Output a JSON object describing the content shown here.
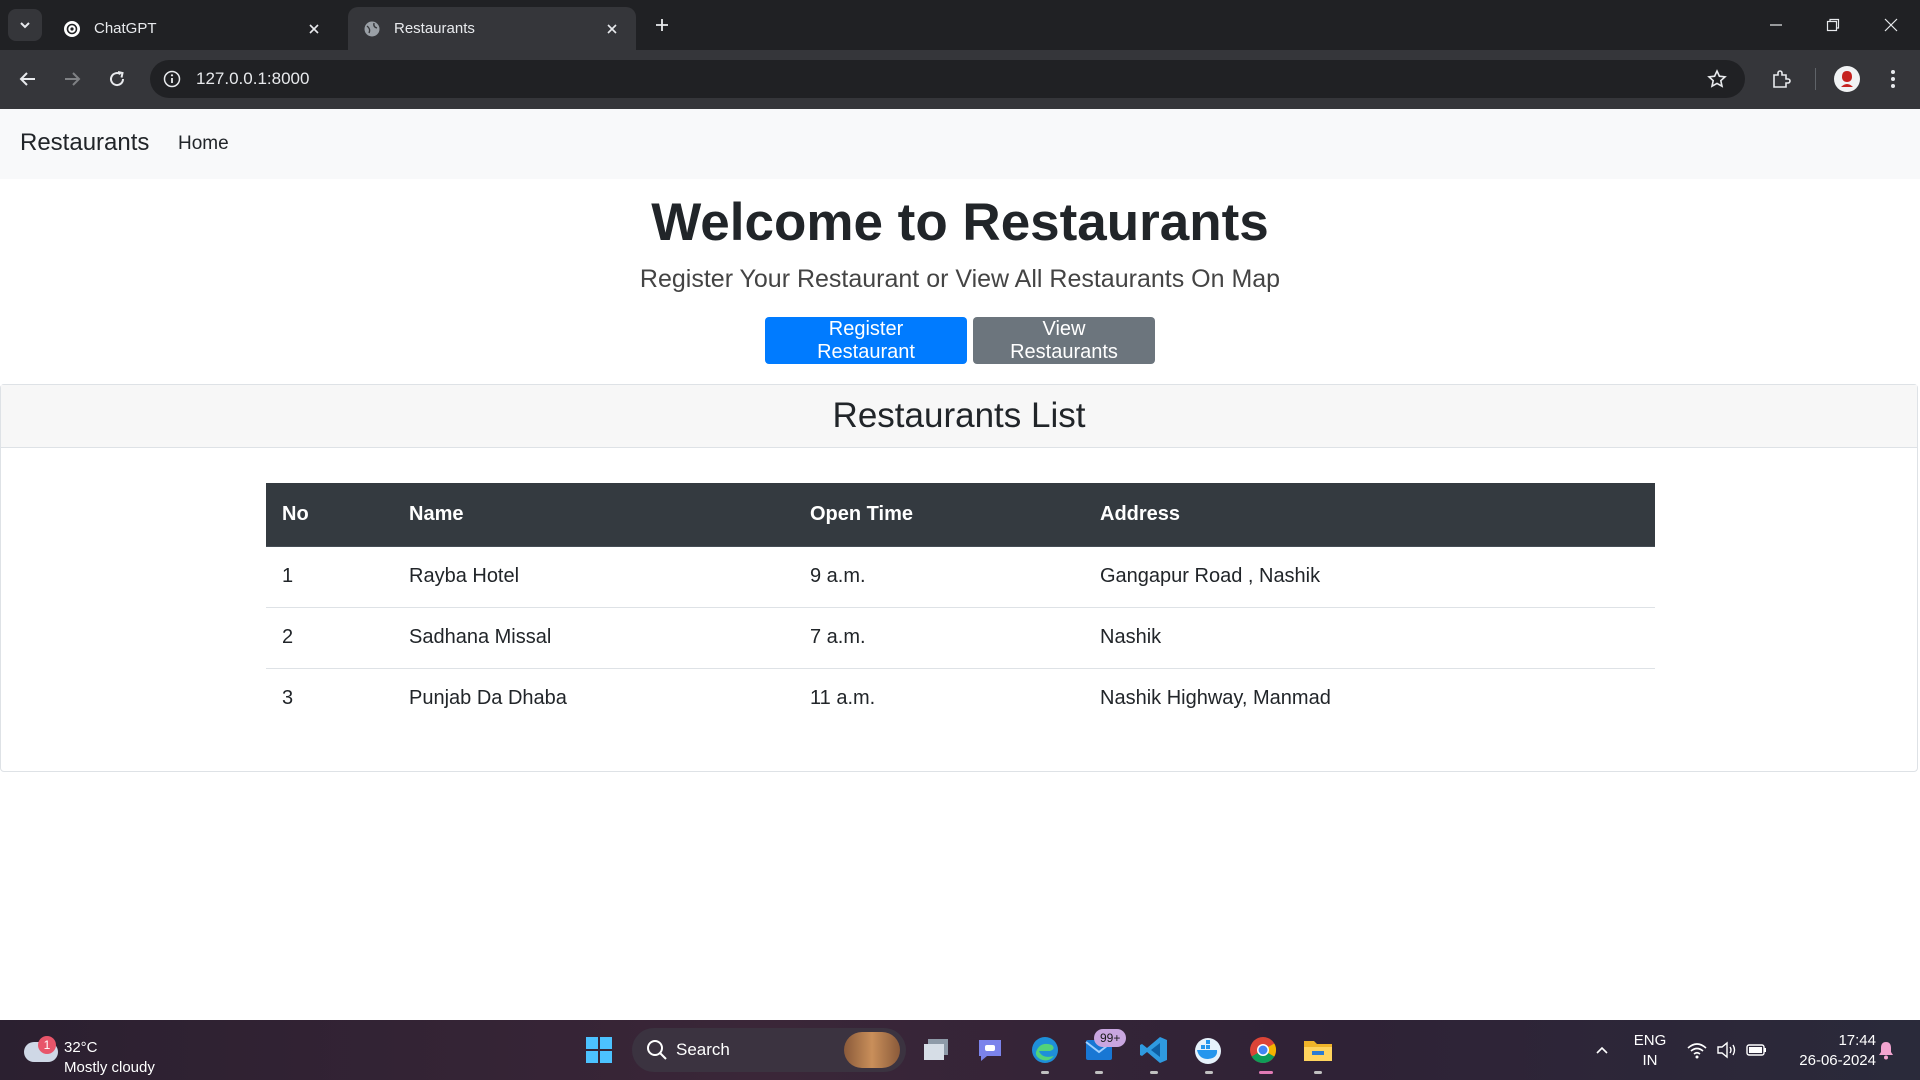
{
  "browser": {
    "tabs": [
      {
        "title": "ChatGPT",
        "icon": "chatgpt-icon",
        "active": false
      },
      {
        "title": "Restaurants",
        "icon": "globe-icon",
        "active": true
      }
    ],
    "url": "127.0.0.1:8000"
  },
  "page": {
    "navbar": {
      "brand": "Restaurants",
      "links": [
        "Home"
      ]
    },
    "hero": {
      "title": "Welcome to Restaurants",
      "subtitle": "Register Your Restaurant or View All Restaurants On Map",
      "buttons": [
        {
          "label": "Register Restaurant",
          "color": "#007bff"
        },
        {
          "label": "View Restaurants",
          "color": "#6c757d"
        }
      ]
    },
    "list": {
      "header": "Restaurants List",
      "columns": [
        "No",
        "Name",
        "Open Time",
        "Address"
      ],
      "rows": [
        [
          "1",
          "Rayba Hotel",
          "9 a.m.",
          "Gangapur Road , Nashik"
        ],
        [
          "2",
          "Sadhana Missal",
          "7 a.m.",
          "Nashik"
        ],
        [
          "3",
          "Punjab Da Dhaba",
          "11 a.m.",
          "Nashik Highway, Manmad"
        ]
      ]
    }
  },
  "taskbar": {
    "weather": {
      "badge": "1",
      "temp": "32°C",
      "desc": "Mostly cloudy"
    },
    "search_label": "Search",
    "teams_badge": "99+",
    "lang": "ENG",
    "region": "IN",
    "time": "17:44",
    "date": "26-06-2024"
  }
}
